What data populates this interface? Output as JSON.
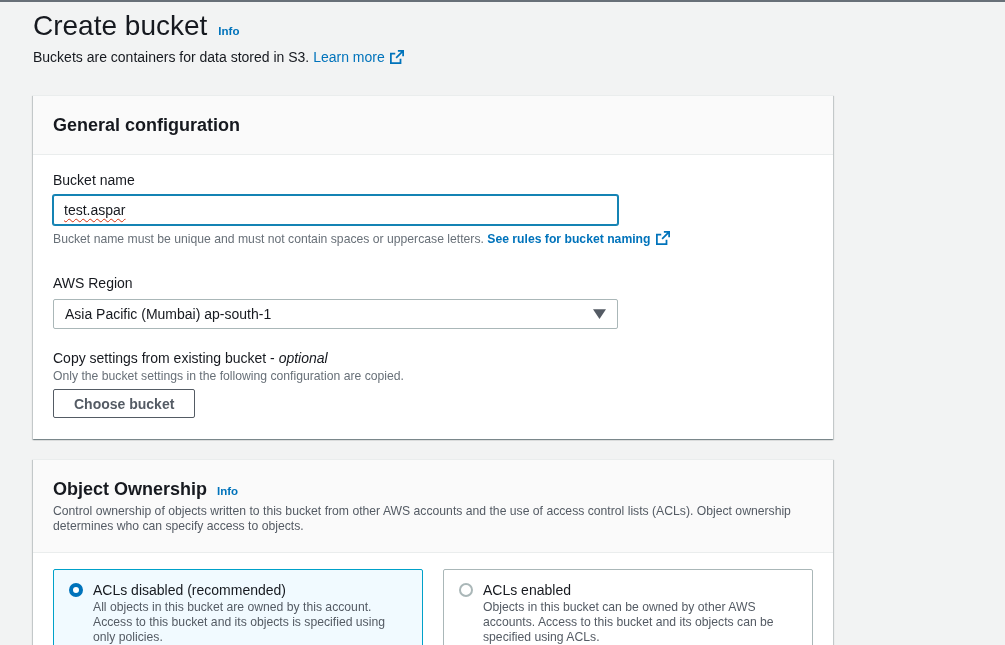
{
  "page_header": {
    "title": "Create bucket",
    "info_link": "Info",
    "description": "Buckets are containers for data stored in S3.",
    "learn_more_link": "Learn more"
  },
  "general_configuration": {
    "heading": "General configuration",
    "bucket_name": {
      "label": "Bucket name",
      "value": "test.aspar",
      "misspelled": true,
      "hint": "Bucket name must be unique and must not contain spaces or uppercase letters.",
      "hint_link": "See rules for bucket naming"
    },
    "aws_region": {
      "label": "AWS Region",
      "value": "Asia Pacific (Mumbai) ap-south-1"
    },
    "copy_settings": {
      "label": "Copy settings from existing bucket - *optional*",
      "hint": "Only the bucket settings in the following configuration are copied.",
      "button": "Choose bucket"
    }
  },
  "object_ownership": {
    "heading": "Object Ownership",
    "info_link": "Info",
    "description": "Control ownership of objects written to this bucket from other AWS accounts and the use of access control lists (ACLs). Object ownership determines who can specify access to objects.",
    "options": [
      {
        "title": "ACLs disabled (recommended)",
        "description": "All objects in this bucket are owned by this account. Access to this bucket and its objects is specified using only policies.",
        "selected": true
      },
      {
        "title": "ACLs enabled",
        "description": "Objects in this bucket can be owned by other AWS accounts. Access to this bucket and its objects can be specified using ACLs.",
        "selected": false
      }
    ]
  }
}
